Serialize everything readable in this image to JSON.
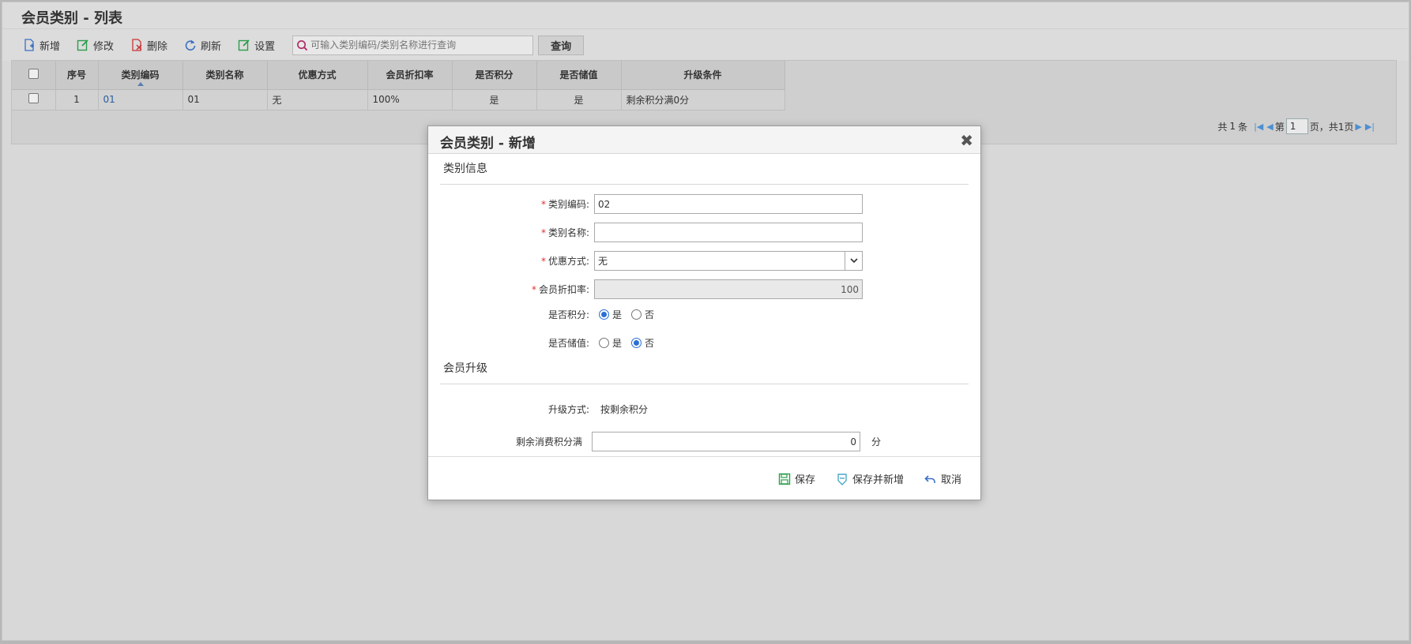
{
  "page": {
    "title": "会员类别 - 列表"
  },
  "toolbar": {
    "add_label": "新增",
    "edit_label": "修改",
    "delete_label": "删除",
    "refresh_label": "刷新",
    "settings_label": "设置",
    "search_placeholder": "可输入类别编码/类别名称进行查询",
    "query_label": "查询"
  },
  "grid": {
    "columns": [
      "序号",
      "类别编码",
      "类别名称",
      "优惠方式",
      "会员折扣率",
      "是否积分",
      "是否储值",
      "升级条件"
    ],
    "rows": [
      {
        "index": "1",
        "code": "01",
        "name": "01",
        "discount_mode": "无",
        "rate": "100%",
        "points": "是",
        "stored_value": "是",
        "upgrade": "剩余积分满0分"
      }
    ]
  },
  "pager": {
    "total_prefix": "共",
    "total_count": "1",
    "total_suffix": "条",
    "page_prefix": "第",
    "current_page": "1",
    "page_suffix": "页，共1页"
  },
  "modal": {
    "title": "会员类别 - 新增",
    "section_info": "类别信息",
    "section_upgrade": "会员升级",
    "fields": {
      "code_label": "类别编码:",
      "code_value": "02",
      "name_label": "类别名称:",
      "name_value": "",
      "discount_label": "优惠方式:",
      "discount_value": "无",
      "rate_label": "会员折扣率:",
      "rate_value": "100",
      "points_label": "是否积分:",
      "points_yes": "是",
      "points_no": "否",
      "stored_label": "是否储值:",
      "stored_yes": "是",
      "stored_no": "否",
      "upgrade_mode_label": "升级方式:",
      "upgrade_mode_value": "按剩余积分",
      "threshold_label": "剩余消费积分满",
      "threshold_value": "0",
      "threshold_unit": "分"
    },
    "points_selected": "yes",
    "stored_selected": "no",
    "buttons": {
      "save": "保存",
      "save_and_new": "保存并新增",
      "cancel": "取消"
    }
  },
  "colors": {
    "accent_blue": "#2b6fd6",
    "required_red": "#e03030",
    "save_green": "#2a9d4a"
  }
}
